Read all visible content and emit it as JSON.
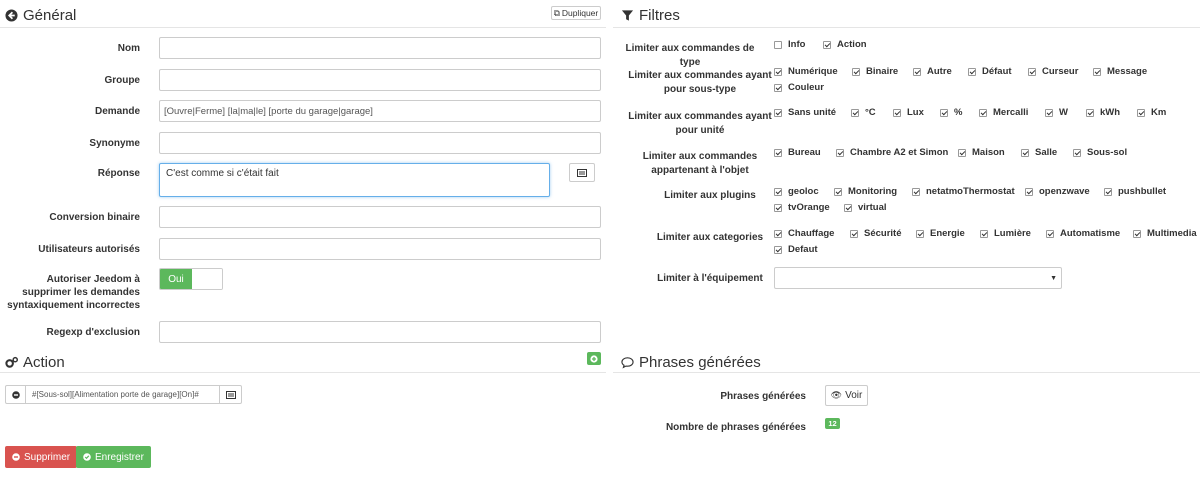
{
  "general": {
    "title": "Général",
    "duplicate_label": "Dupliquer",
    "fields": {
      "nom": {
        "label": "Nom",
        "value": ""
      },
      "groupe": {
        "label": "Groupe",
        "value": ""
      },
      "demande": {
        "label": "Demande",
        "value": "[Ouvre|Ferme] [la|ma|le] [porte du garage|garage]"
      },
      "synonyme": {
        "label": "Synonyme",
        "value": ""
      },
      "reponse": {
        "label": "Réponse",
        "value": "C'est comme si c'était fait"
      },
      "conversion": {
        "label": "Conversion binaire",
        "value": ""
      },
      "utilisateurs": {
        "label": "Utilisateurs autorisés",
        "value": ""
      },
      "autoriser": {
        "label": "Autoriser Jeedom à supprimer les demandes syntaxiquement incorrectes",
        "toggle_on": "Oui"
      },
      "regexp": {
        "label": "Regexp d'exclusion",
        "value": ""
      }
    }
  },
  "action": {
    "title": "Action",
    "command_value": "#[Sous-sol][Alimentation porte de garage][On]#"
  },
  "buttons": {
    "delete": "Supprimer",
    "save": "Enregistrer"
  },
  "filtres": {
    "title": "Filtres",
    "type": {
      "label": "Limiter aux commandes de type",
      "items": [
        {
          "label": "Info",
          "checked": false
        },
        {
          "label": "Action",
          "checked": true
        }
      ]
    },
    "subtype": {
      "label": "Limiter aux commandes ayant pour sous-type",
      "items": [
        "Numérique",
        "Binaire",
        "Autre",
        "Défaut",
        "Curseur",
        "Message",
        "Couleur"
      ]
    },
    "unit": {
      "label": "Limiter aux commandes ayant pour unité",
      "items": [
        "Sans unité",
        "°C",
        "Lux",
        "%",
        "Mercalli",
        "W",
        "kWh",
        "Km"
      ]
    },
    "object": {
      "label": "Limiter aux commandes appartenant à l'objet",
      "items": [
        "Bureau",
        "Chambre A2 et Simon",
        "Maison",
        "Salle",
        "Sous-sol"
      ]
    },
    "plugins": {
      "label": "Limiter aux plugins",
      "items": [
        "geoloc",
        "Monitoring",
        "netatmoThermostat",
        "openzwave",
        "pushbullet",
        "tvOrange",
        "virtual"
      ]
    },
    "categories": {
      "label": "Limiter aux categories",
      "items": [
        "Chauffage",
        "Sécurité",
        "Energie",
        "Lumière",
        "Automatisme",
        "Multimedia",
        "Defaut"
      ]
    },
    "equipment": {
      "label": "Limiter à l'équipement",
      "value": ""
    }
  },
  "phrases": {
    "title": "Phrases générées",
    "generated_label": "Phrases générées",
    "view_button": "Voir",
    "count_label": "Nombre de phrases générées",
    "count": "12"
  }
}
